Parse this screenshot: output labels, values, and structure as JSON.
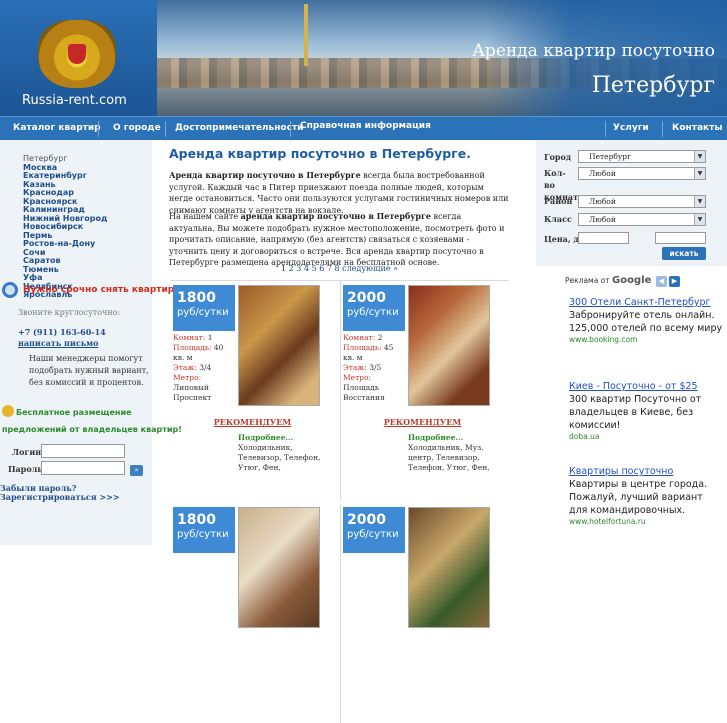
{
  "header": {
    "logo_text": "Russia-rent.com",
    "title_line1": "Аренда квартир посуточно",
    "title_line2": "Петербург"
  },
  "nav": {
    "items": [
      "Каталог квартир",
      "О городе",
      "Достопримечательности",
      "Справочная информация",
      "Услуги",
      "Контакты"
    ]
  },
  "sidebar": {
    "current_city": "Петербург",
    "cities": [
      "Москва",
      "Екатеринбург",
      "Казань",
      "Краснодар",
      "Красноярск",
      "Калининград",
      "Нижний Новгород",
      "Новосибирск",
      "Пермь",
      "Ростов-на-Дону",
      "Сочи",
      "Саратов",
      "Тюмень",
      "Уфа",
      "Челябинск",
      "Ярославль"
    ],
    "rent_question": "Нужно срочно снять квартиру?",
    "call_text": "Звоните круглосуточно:",
    "phone": "+7 (911) 163-60-14",
    "write_link": "написать письмо",
    "managers_text": "Наши менеджеры помогут подобрать нужный вариант, без комиссий и процентов.",
    "free_line1": "Бесплатное размещение",
    "free_line2": "предложений от владельцев квартир!",
    "login_label": "Логин:",
    "password_label": "Пароль:",
    "go_label": "»",
    "forgot": "Забыли пароль?",
    "register": "Зарегистрироваться >>>"
  },
  "main": {
    "title": "Аренда квартир посуточно в Петербурге.",
    "para1_bold": "Аренда квартир посуточно в Петербурге",
    "para1_rest": " всегда была востребованной услугой. Каждый час в Питер приезжают поезда полные людей, которым негде остановиться. Часто они пользуются услугами гостиничных номеров или снимают комнаты у агентств на вокзале.",
    "para2_start": "На нашем сайте ",
    "para2_bold": "аренда квартир посуточно в Петербурге",
    "para2_rest": " всегда актуальна. Вы можете подобрать нужное местоположение, посмотреть фото и прочитать описание, напрямую (без агентств) связаться с хозяевами - уточнить цену и договориться о встрече. Вся аренда квартир посуточно в Петербурге размещена арендодателями на бесплатной основе.",
    "pager_pages": "2 3 4 5 6 7 8",
    "pager_current": "1",
    "pager_next": "следующие »"
  },
  "listings": [
    {
      "price": "1800",
      "unit": "руб/сутки",
      "rooms_label": "Комнат:",
      "rooms": "1",
      "area_label": "Площадь:",
      "area": "40 кв. м",
      "floor_label": "Этаж:",
      "floor": "3/4",
      "metro_label": "Метро:",
      "metro": "Липовый Проспект",
      "recommend": "РЕКОМЕНДУЕМ",
      "more": "Подробнее...",
      "features": "Холодильник, Телевизор, Телефон, Утюг, Фен,"
    },
    {
      "price": "2000",
      "unit": "руб/сутки",
      "rooms_label": "Комнат:",
      "rooms": "2",
      "area_label": "Площадь:",
      "area": "45 кв. м",
      "floor_label": "Этаж:",
      "floor": "3/5",
      "metro_label": "Метро:",
      "metro": "Площадь Восстания",
      "recommend": "РЕКОМЕНДУЕМ",
      "more": "Подробнее...",
      "features": "Холодильник, Муз. центр, Телевизор, Телефон, Утюг, Фен,"
    },
    {
      "price": "1800",
      "unit": "руб/сутки"
    },
    {
      "price": "2000",
      "unit": "руб/сутки"
    }
  ],
  "search": {
    "city_label": "Город",
    "city_value": "Петербург",
    "rooms_label": "Кол-во комнат",
    "rooms_value": "Любой",
    "district_label": "Район",
    "district_value": "Любой",
    "class_label": "Класс",
    "class_value": "Любой",
    "price_label": "Цена, до",
    "button": "искать"
  },
  "ads": {
    "header": "Реклама от",
    "brand": "Google",
    "items": [
      {
        "title": "300 Отели Санкт-Петербург",
        "text": "Забронируйте отель онлайн. 125,000 отелей по всему миру",
        "url": "www.booking.com"
      },
      {
        "title": "Киев - Посуточно - от $25",
        "text": "300 квартир Посуточно от владельцев в Киеве, без комиссии!",
        "url": "doba.ua"
      },
      {
        "title": "Квартиры посуточно",
        "text": "Квартиры в центре города. Пожалуй, лучший вариант для командировочных.",
        "url": "www.hotelfortuna.ru"
      }
    ]
  },
  "colors": {
    "brand_blue": "#1d5fa3",
    "nav_blue": "#2b72b8",
    "accent_red": "#c0392b",
    "link_green": "#2c8a2c"
  }
}
